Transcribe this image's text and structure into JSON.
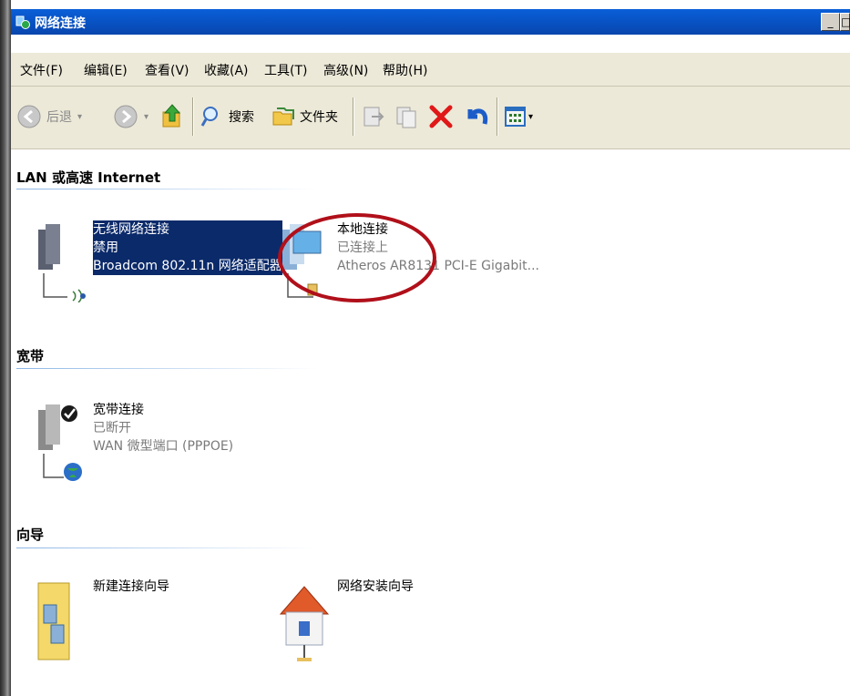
{
  "window": {
    "title": "网络连接"
  },
  "menu": [
    "文件(F)",
    "编辑(E)",
    "查看(V)",
    "收藏(A)",
    "工具(T)",
    "高级(N)",
    "帮助(H)"
  ],
  "toolbar": {
    "back": "后退",
    "search": "搜索",
    "folders": "文件夹"
  },
  "groups": {
    "lan": "LAN 或高速 Internet",
    "broadband": "宽带",
    "wizard": "向导"
  },
  "connections": {
    "wireless": {
      "name": "无线网络连接",
      "status": "禁用",
      "device": "Broadcom 802.11n 网络适配器"
    },
    "local": {
      "name": "本地连接",
      "status": "已连接上",
      "device": "Atheros AR8131 PCI-E Gigabit..."
    },
    "broadband": {
      "name": "宽带连接",
      "status": "已断开",
      "device": "WAN 微型端口 (PPPOE)"
    }
  },
  "wizards": {
    "new_connection": "新建连接向导",
    "network_setup": "网络安装向导"
  },
  "colors": {
    "titlebar": "#0850c0",
    "annotation_ellipse": "#b0101a",
    "selection": "#0b2a6a"
  }
}
